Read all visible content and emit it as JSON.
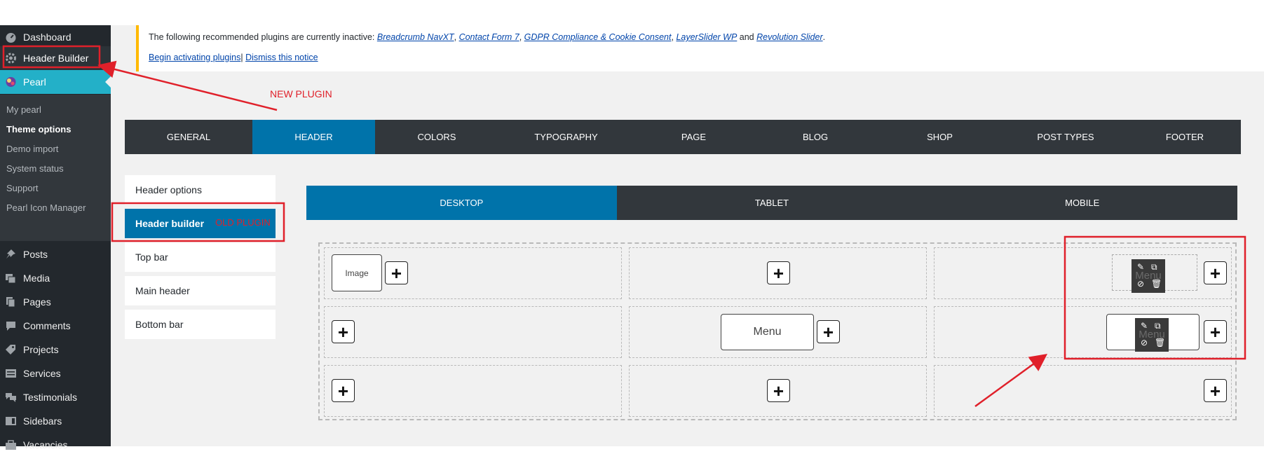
{
  "sidebar": {
    "items": [
      {
        "label": "Dashboard",
        "icon": "gauge-icon"
      },
      {
        "label": "Header Builder",
        "icon": "gear-icon"
      },
      {
        "label": "Pearl",
        "icon": "pearl-logo-icon"
      },
      {
        "label": "Posts",
        "icon": "pin-icon"
      },
      {
        "label": "Media",
        "icon": "media-icon"
      },
      {
        "label": "Pages",
        "icon": "pages-icon"
      },
      {
        "label": "Comments",
        "icon": "comment-icon"
      },
      {
        "label": "Projects",
        "icon": "tag-icon"
      },
      {
        "label": "Services",
        "icon": "list-icon"
      },
      {
        "label": "Testimonials",
        "icon": "comments-icon"
      },
      {
        "label": "Sidebars",
        "icon": "sidebars-icon"
      },
      {
        "label": "Vacancies",
        "icon": "briefcase-icon"
      }
    ],
    "submenu": [
      "My pearl",
      "Theme options",
      "Demo import",
      "System status",
      "Support",
      "Pearl Icon Manager"
    ]
  },
  "notice": {
    "intro": "The following recommended plugins are currently inactive: ",
    "plugins": [
      "Breadcrumb NavXT",
      "Contact Form 7",
      "GDPR Compliance & Cookie Consent",
      "LayerSlider WP"
    ],
    "and_text": " and ",
    "last_plugin": "Revolution Slider",
    "end": ".",
    "activate_link": "Begin activating plugins",
    "separator": "|",
    "dismiss_link": "Dismiss this notice"
  },
  "annotations": {
    "new_plugin": "NEW PLUGIN",
    "old_plugin": "OLD PLUGIN",
    "highlight_color": "#e0202a"
  },
  "tabs": [
    "GENERAL",
    "HEADER",
    "COLORS",
    "TYPOGRAPHY",
    "PAGE",
    "BLOG",
    "SHOP",
    "POST TYPES",
    "FOOTER"
  ],
  "active_tab": "HEADER",
  "options": [
    "Header options",
    "Header builder",
    "Top bar",
    "Main header",
    "Bottom bar"
  ],
  "active_option": "Header builder",
  "devices": [
    "DESKTOP",
    "TABLET",
    "MOBILE"
  ],
  "active_device": "DESKTOP",
  "builder": {
    "image_label": "Image",
    "menu_label": "Menu",
    "ghost_menu_label": "Menu",
    "ghost_menu_label_2": "Menu",
    "add_symbol": "+",
    "tool_icons": [
      "pencil-icon",
      "copy-icon",
      "eye-slash-icon",
      "trash-icon"
    ]
  },
  "colors": {
    "admin_bar": "#23282d",
    "accent": "#0073aa",
    "pearl_highlight": "#23b0c8",
    "notice_border": "#ffb900"
  }
}
